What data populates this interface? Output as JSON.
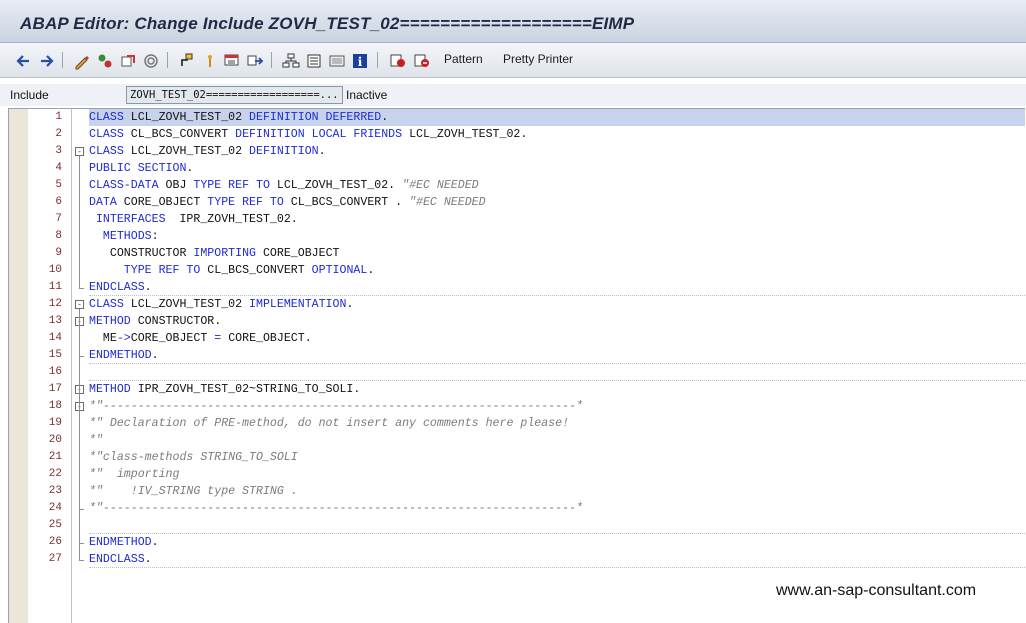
{
  "window": {
    "title": "ABAP Editor: Change Include ZOVH_TEST_02===================EIMP"
  },
  "toolbar": {
    "icons": [
      "back-arrow-icon",
      "forward-arrow-icon",
      "display-change-icon",
      "other-object-icon",
      "activate-icon",
      "check-icon",
      "where-used-icon",
      "navigation-icon",
      "object-list-icon",
      "display-object-icon",
      "hierarchy-icon",
      "enhance-icon",
      "help-info-icon",
      "cut-icon",
      "paste-icon"
    ],
    "pattern_label": "Pattern",
    "pretty_printer_label": "Pretty Printer"
  },
  "info": {
    "include_label": "Include",
    "include_value": "ZOVH_TEST_02==================...",
    "status": "Inactive"
  },
  "code_lines": [
    {
      "n": "1",
      "tokens": [
        {
          "t": "CLASS",
          "c": "kw"
        },
        {
          "t": " LCL_ZOVH_TEST_02 "
        },
        {
          "t": "DEFINITION DEFERRED",
          "c": "kw"
        },
        {
          "t": "."
        }
      ]
    },
    {
      "n": "2",
      "tokens": [
        {
          "t": "CLASS",
          "c": "kw"
        },
        {
          "t": " CL_BCS_CONVERT "
        },
        {
          "t": "DEFINITION LOCAL FRIENDS",
          "c": "kw"
        },
        {
          "t": " LCL_ZOVH_TEST_02."
        }
      ]
    },
    {
      "n": "3",
      "tokens": [
        {
          "t": "CLASS",
          "c": "kw"
        },
        {
          "t": " LCL_ZOVH_TEST_02 "
        },
        {
          "t": "DEFINITION",
          "c": "kw"
        },
        {
          "t": "."
        }
      ]
    },
    {
      "n": "4",
      "tokens": [
        {
          "t": "PUBLIC SECTION",
          "c": "kw"
        },
        {
          "t": "."
        }
      ]
    },
    {
      "n": "5",
      "tokens": [
        {
          "t": "CLASS-DATA",
          "c": "kw"
        },
        {
          "t": " OBJ "
        },
        {
          "t": "TYPE REF TO",
          "c": "kw"
        },
        {
          "t": " LCL_ZOVH_TEST_02. "
        },
        {
          "t": "\"#EC NEEDED",
          "c": "cm"
        }
      ]
    },
    {
      "n": "6",
      "tokens": [
        {
          "t": "DATA",
          "c": "kw"
        },
        {
          "t": " CORE_OBJECT "
        },
        {
          "t": "TYPE REF TO",
          "c": "kw"
        },
        {
          "t": " CL_BCS_CONVERT . "
        },
        {
          "t": "\"#EC NEEDED",
          "c": "cm"
        }
      ]
    },
    {
      "n": "7",
      "tokens": [
        {
          "t": " "
        },
        {
          "t": "INTERFACES",
          "c": "kw"
        },
        {
          "t": "  IPR_ZOVH_TEST_02."
        }
      ]
    },
    {
      "n": "8",
      "tokens": [
        {
          "t": "  "
        },
        {
          "t": "METHODS",
          "c": "kw"
        },
        {
          "t": ":"
        }
      ]
    },
    {
      "n": "9",
      "tokens": [
        {
          "t": "   CONSTRUCTOR "
        },
        {
          "t": "IMPORTING",
          "c": "kw"
        },
        {
          "t": " CORE_OBJECT"
        }
      ]
    },
    {
      "n": "10",
      "tokens": [
        {
          "t": "     "
        },
        {
          "t": "TYPE REF TO",
          "c": "kw"
        },
        {
          "t": " CL_BCS_CONVERT "
        },
        {
          "t": "OPTIONAL",
          "c": "kw"
        },
        {
          "t": "."
        }
      ]
    },
    {
      "n": "11",
      "tokens": [
        {
          "t": "ENDCLASS",
          "c": "kw"
        },
        {
          "t": "."
        }
      ]
    },
    {
      "n": "12",
      "tokens": [
        {
          "t": "CLASS",
          "c": "kw"
        },
        {
          "t": " LCL_ZOVH_TEST_02 "
        },
        {
          "t": "IMPLEMENTATION",
          "c": "kw"
        },
        {
          "t": "."
        }
      ]
    },
    {
      "n": "13",
      "tokens": [
        {
          "t": "METHOD",
          "c": "kw"
        },
        {
          "t": " CONSTRUCTOR."
        }
      ]
    },
    {
      "n": "14",
      "tokens": [
        {
          "t": "  ME"
        },
        {
          "t": "->",
          "c": "op"
        },
        {
          "t": "CORE_OBJECT "
        },
        {
          "t": "=",
          "c": "op"
        },
        {
          "t": " CORE_OBJECT."
        }
      ]
    },
    {
      "n": "15",
      "tokens": [
        {
          "t": "ENDMETHOD",
          "c": "kw"
        },
        {
          "t": "."
        }
      ]
    },
    {
      "n": "16",
      "tokens": []
    },
    {
      "n": "17",
      "tokens": [
        {
          "t": "METHOD",
          "c": "kw"
        },
        {
          "t": " IPR_ZOVH_TEST_02~STRING_TO_SOLI."
        }
      ]
    },
    {
      "n": "18",
      "tokens": [
        {
          "t": "*\"--------------------------------------------------------------------*",
          "c": "cm"
        }
      ]
    },
    {
      "n": "19",
      "tokens": [
        {
          "t": "*\" Declaration of PRE-method, do not insert any comments here please!",
          "c": "cm"
        }
      ]
    },
    {
      "n": "20",
      "tokens": [
        {
          "t": "*\"",
          "c": "cm"
        }
      ]
    },
    {
      "n": "21",
      "tokens": [
        {
          "t": "*\"class-methods STRING_TO_SOLI",
          "c": "cm"
        }
      ]
    },
    {
      "n": "22",
      "tokens": [
        {
          "t": "*\"  importing",
          "c": "cm"
        }
      ]
    },
    {
      "n": "23",
      "tokens": [
        {
          "t": "*\"    !IV_STRING type STRING .",
          "c": "cm"
        }
      ]
    },
    {
      "n": "24",
      "tokens": [
        {
          "t": "*\"--------------------------------------------------------------------*",
          "c": "cm"
        }
      ]
    },
    {
      "n": "25",
      "tokens": []
    },
    {
      "n": "26",
      "tokens": [
        {
          "t": "ENDMETHOD",
          "c": "kw"
        },
        {
          "t": "."
        }
      ]
    },
    {
      "n": "27",
      "tokens": [
        {
          "t": "ENDCLASS",
          "c": "kw"
        },
        {
          "t": "."
        }
      ]
    }
  ],
  "watermark": "www.an-sap-consultant.com",
  "colors": {
    "keyword": "#1d2bd6",
    "comment": "#7c7c7c",
    "current_line": "#c7d2ec",
    "line_number": "#7a2e2e"
  }
}
